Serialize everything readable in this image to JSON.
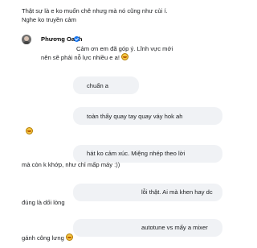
{
  "comment_top": {
    "line1": "Thật sự là e ko muốn chê nhưg mà nó cũng như cùi í.",
    "line2": "Nghe ko truyền cảm"
  },
  "reply": {
    "author": "Phương Oanh",
    "line1": "Cảm ơn em đã góp ý. Lĩnh vực mới",
    "line2": "nên sẽ phải nỗ lực nhiều e a!"
  },
  "messages": [
    {
      "line1": "chuẩn a"
    },
    {
      "line1": "toàn thấy quay tay quay váy hok ah"
    },
    {
      "line1": "hát ko cảm xúc. Miệng nhép theo lời",
      "line2": "mà còn k khớp, như chỉ mấp máy :))"
    },
    {
      "line1": "lỗi thật. Ai mà khen hay dc",
      "line2": "đúng là dối lòng"
    },
    {
      "line1": "autotune vs mấy a mixer",
      "line2": "gánh công lưng"
    }
  ],
  "icons": {
    "avatar": "user-avatar",
    "verified": "verified-badge-icon",
    "emoji": "laughing-emoji-icon"
  },
  "colors": {
    "bubble": "#f0f2f5",
    "verified": "#1877f2",
    "text": "#1c1e21"
  }
}
